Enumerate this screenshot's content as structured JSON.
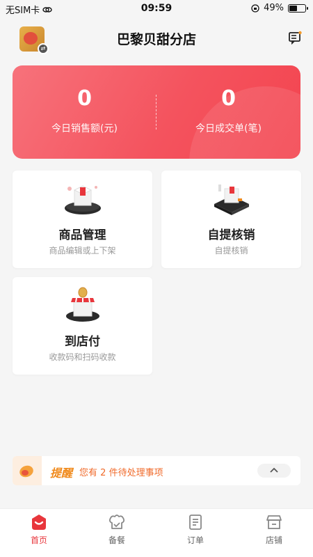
{
  "status_bar": {
    "carrier": "无SIM卡",
    "time": "09:59",
    "battery_percent": "49%",
    "battery_level": 0.49
  },
  "header": {
    "title": "巴黎贝甜分店"
  },
  "stats": [
    {
      "value": "0",
      "label": "今日销售额(元)"
    },
    {
      "value": "0",
      "label": "今日成交单(笔)"
    }
  ],
  "tiles": [
    {
      "title": "商品管理",
      "subtitle": "商品编辑或上下架",
      "icon": "product-box-icon"
    },
    {
      "title": "自提核销",
      "subtitle": "自提核销",
      "icon": "pickup-box-icon"
    },
    {
      "title": "到店付",
      "subtitle": "收款码和扫码收款",
      "icon": "store-pay-icon"
    }
  ],
  "reminder": {
    "tag": "提醒",
    "text_prefix": "您有",
    "count": "2",
    "text_suffix": "件待处理事项"
  },
  "tabbar": [
    {
      "label": "首页",
      "icon": "home-icon",
      "active": true
    },
    {
      "label": "备餐",
      "icon": "chef-hat-icon",
      "active": false
    },
    {
      "label": "订单",
      "icon": "order-list-icon",
      "active": false
    },
    {
      "label": "店铺",
      "icon": "shop-icon",
      "active": false
    }
  ],
  "colors": {
    "accent": "#e8363c",
    "card_gradient_start": "#f7727b",
    "card_gradient_end": "#f3444f",
    "reminder_orange": "#f06a2a"
  }
}
